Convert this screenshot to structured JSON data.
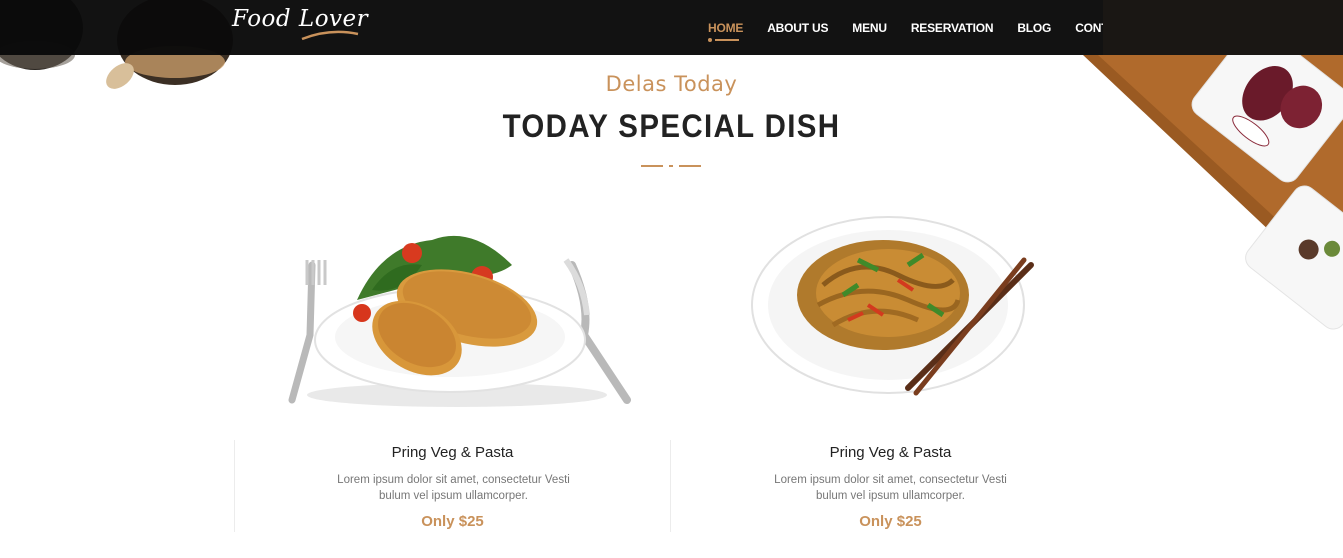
{
  "brand": {
    "logo_text": "Food Lover"
  },
  "nav": {
    "items": [
      {
        "label": "HOME",
        "active": true
      },
      {
        "label": "ABOUT US",
        "active": false
      },
      {
        "label": "MENU",
        "active": false
      },
      {
        "label": "RESERVATION",
        "active": false
      },
      {
        "label": "BLOG",
        "active": false
      },
      {
        "label": "CONTACT US",
        "active": false
      }
    ]
  },
  "section": {
    "eyebrow": "Delas Today",
    "title": "TODAY SPECIAL DISH"
  },
  "dishes": [
    {
      "name": "Pring Veg & Pasta",
      "description": "Lorem ipsum dolor sit amet, consectetur Vesti bulum vel ipsum ullamcorper.",
      "price": "Only $25",
      "image": "breaded-cutlet-with-salad-plate"
    },
    {
      "name": "Pring Veg & Pasta",
      "description": "Lorem ipsum dolor sit amet, consectetur Vesti bulum vel ipsum ullamcorper.",
      "price": "Only $25",
      "image": "stir-fried-noodles-with-chopsticks-plate"
    }
  ],
  "colors": {
    "accent": "#c9925b",
    "header_bg": "#0a0a0a",
    "heading": "#222222",
    "body_text": "#777777"
  }
}
